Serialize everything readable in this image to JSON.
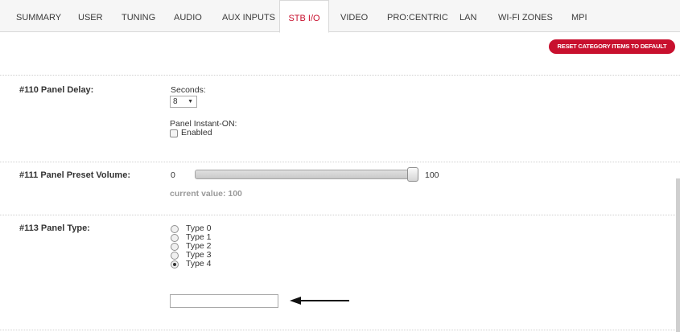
{
  "tabs": [
    {
      "label": "SUMMARY"
    },
    {
      "label": "USER"
    },
    {
      "label": "TUNING"
    },
    {
      "label": "AUDIO"
    },
    {
      "label": "AUX INPUTS"
    },
    {
      "label": "STB I/O",
      "active": true
    },
    {
      "label": "VIDEO"
    },
    {
      "label": "PRO:CENTRIC"
    },
    {
      "label": "LAN"
    },
    {
      "label": "WI-FI ZONES"
    },
    {
      "label": "MPI"
    }
  ],
  "reset_button": "RESET CATEGORY ITEMS TO DEFAULT",
  "panel_delay": {
    "label": "#110 Panel Delay:",
    "seconds_label": "Seconds:",
    "seconds_value": "8",
    "instant_on_label": "Panel Instant-ON:",
    "enabled_label": "Enabled",
    "enabled_checked": false
  },
  "preset_volume": {
    "label": "#111 Panel Preset Volume:",
    "min": "0",
    "max": "100",
    "current_value_text": "current value: 100",
    "value": 100
  },
  "panel_type": {
    "label": "#113 Panel Type:",
    "options": [
      "Type 0",
      "Type 1",
      "Type 2",
      "Type 3",
      "Type 4"
    ],
    "selected": "Type 4",
    "text_value": ""
  },
  "colors": {
    "accent": "#c8102e",
    "tab_bar": "#f6f6f6"
  },
  "icons": {
    "annotation": "left-arrow-icon",
    "select_caret": "caret-down-icon"
  }
}
